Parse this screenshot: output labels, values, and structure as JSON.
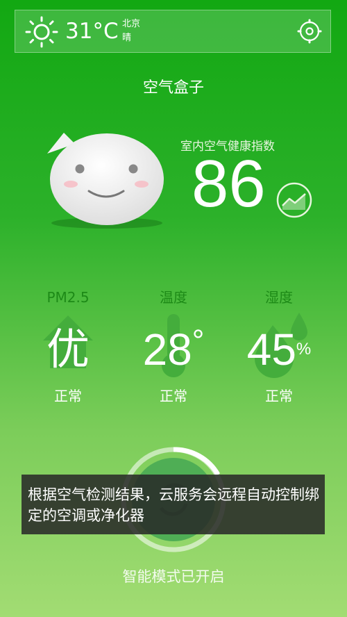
{
  "weather": {
    "temperature": "31°C",
    "city": "北京",
    "condition": "晴"
  },
  "app": {
    "title": "空气盒子"
  },
  "index": {
    "label": "室内空气健康指数",
    "value": "86"
  },
  "metrics": [
    {
      "title": "PM2.5",
      "value": "优",
      "status": "正常",
      "icon": "house-icon"
    },
    {
      "title": "温度",
      "value": "28",
      "unit": "°",
      "status": "正常",
      "icon": "thermometer-icon"
    },
    {
      "title": "湿度",
      "value": "45",
      "unit": "%",
      "status": "正常",
      "icon": "water-drop-icon"
    }
  ],
  "tooltip": {
    "text": "根据空气检测结果，云服务会远程自动控制绑定的空调或净化器"
  },
  "mode": {
    "label": "智能模式已开启"
  },
  "colors": {
    "bg_top": "#12a812",
    "bg_bottom": "#a2dc73",
    "metric_title": "#1d8a17",
    "tooltip_bg": "#282828"
  }
}
